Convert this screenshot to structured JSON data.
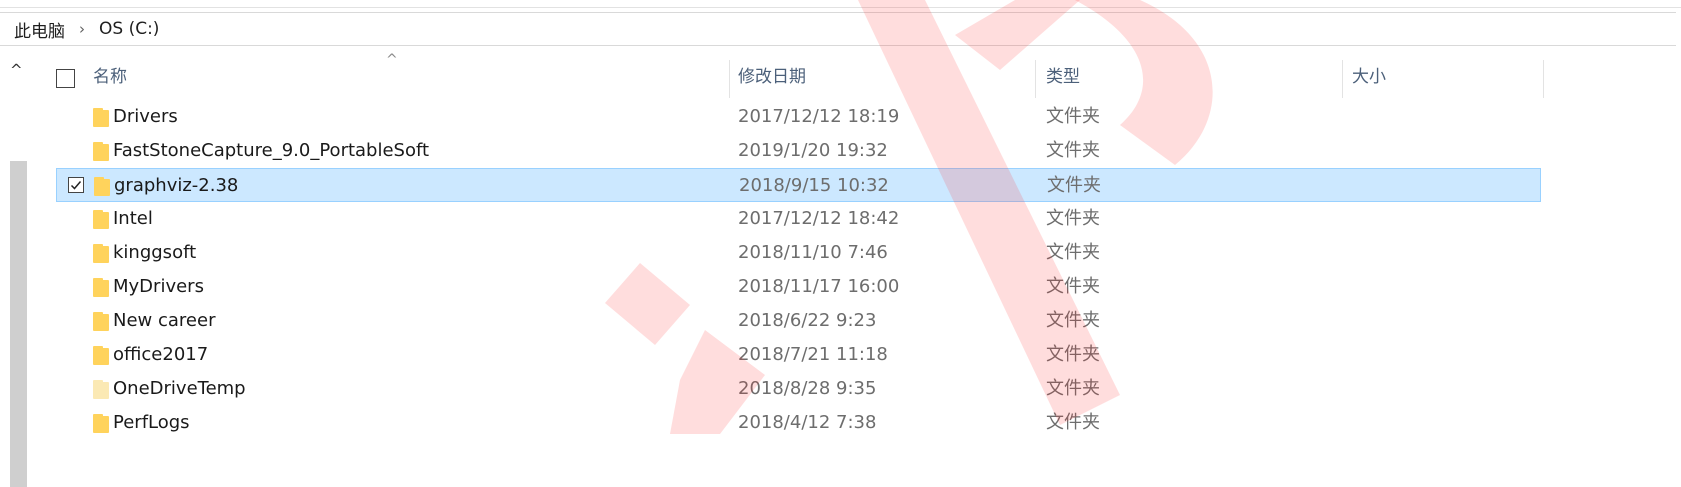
{
  "breadcrumb": {
    "root": "此电脑",
    "separator": "›",
    "current": "OS (C:)"
  },
  "columns": {
    "name": "名称",
    "date": "修改日期",
    "type": "类型",
    "size": "大小"
  },
  "colors": {
    "selection_bg": "#cce8ff",
    "selection_border": "#99d1ff",
    "folder_yellow": "#ffd35c",
    "watermark": "#ff3b3b"
  },
  "files": [
    {
      "name": "Drivers",
      "date": "2017/12/12 18:19",
      "type": "文件夹",
      "selected": false,
      "faded": false
    },
    {
      "name": "FastStoneCapture_9.0_PortableSoft",
      "date": "2019/1/20 19:32",
      "type": "文件夹",
      "selected": false,
      "faded": false
    },
    {
      "name": "graphviz-2.38",
      "date": "2018/9/15 10:32",
      "type": "文件夹",
      "selected": true,
      "faded": false
    },
    {
      "name": "Intel",
      "date": "2017/12/12 18:42",
      "type": "文件夹",
      "selected": false,
      "faded": false
    },
    {
      "name": "kinggsoft",
      "date": "2018/11/10 7:46",
      "type": "文件夹",
      "selected": false,
      "faded": false
    },
    {
      "name": "MyDrivers",
      "date": "2018/11/17 16:00",
      "type": "文件夹",
      "selected": false,
      "faded": false
    },
    {
      "name": "New career",
      "date": "2018/6/22 9:23",
      "type": "文件夹",
      "selected": false,
      "faded": false
    },
    {
      "name": "office2017",
      "date": "2018/7/21 11:18",
      "type": "文件夹",
      "selected": false,
      "faded": false
    },
    {
      "name": "OneDriveTemp",
      "date": "2018/8/28 9:35",
      "type": "文件夹",
      "selected": false,
      "faded": true
    },
    {
      "name": "PerfLogs",
      "date": "2018/4/12 7:38",
      "type": "文件夹",
      "selected": false,
      "faded": false
    }
  ]
}
